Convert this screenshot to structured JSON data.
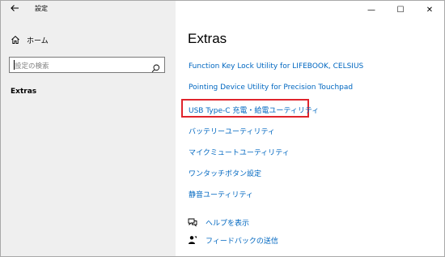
{
  "window": {
    "title": "設定",
    "controls": {
      "minimize": "—",
      "maximize": "☐",
      "close": "✕"
    }
  },
  "sidebar": {
    "home_label": "ホーム",
    "search_placeholder": "設定の検索",
    "nav_item": "Extras"
  },
  "main": {
    "title": "Extras",
    "links": [
      "Function Key Lock Utility for LIFEBOOK, CELSIUS",
      "Pointing Device Utility for Precision Touchpad",
      "USB Type-C 充電・給電ユーティリティ",
      "バッテリーユーティリティ",
      "マイクミュートユーティリティ",
      "ワンタッチボタン設定",
      "静音ユーティリティ"
    ],
    "help": "ヘルプを表示",
    "feedback": "フィードバックの送信"
  },
  "colors": {
    "link": "#0067c0",
    "highlight": "#e0242c",
    "sidebar_bg": "#efefef"
  }
}
